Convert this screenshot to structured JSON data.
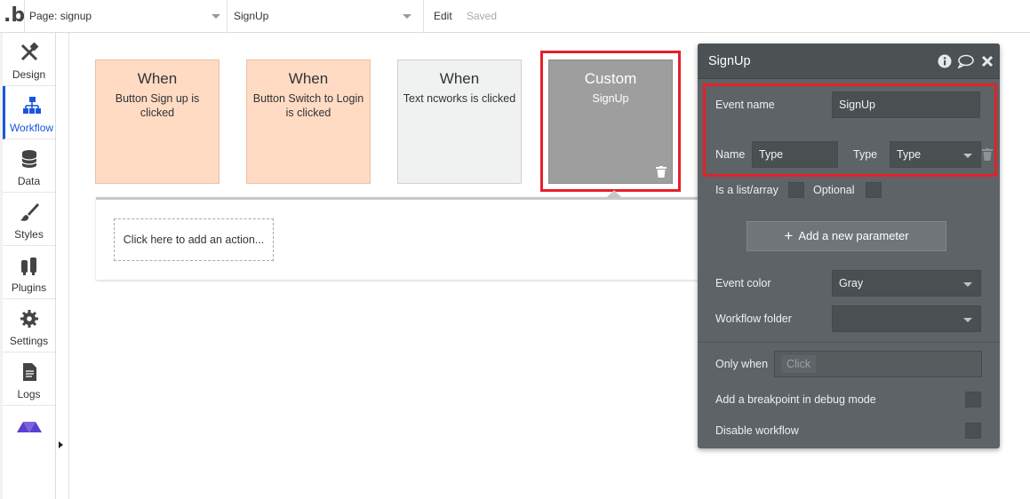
{
  "topbar": {
    "page_select": "Page: signup",
    "workflow_select": "SignUp",
    "edit_label": "Edit",
    "saved_label": "Saved"
  },
  "sidebar": {
    "items": [
      {
        "label": "Design",
        "icon": "design-icon"
      },
      {
        "label": "Workflow",
        "icon": "workflow-icon",
        "active": true
      },
      {
        "label": "Data",
        "icon": "database-icon"
      },
      {
        "label": "Styles",
        "icon": "brush-icon"
      },
      {
        "label": "Plugins",
        "icon": "plug-icon"
      },
      {
        "label": "Settings",
        "icon": "gear-icon"
      },
      {
        "label": "Logs",
        "icon": "document-icon"
      },
      {
        "label": "",
        "icon": "triangles-logo-icon"
      }
    ]
  },
  "cards": [
    {
      "title": "When",
      "subtitle": "Button Sign up is clicked",
      "color": "#ffdbc4"
    },
    {
      "title": "When",
      "subtitle": "Button Switch to Login is clicked",
      "color": "#ffdbc4"
    },
    {
      "title": "When",
      "subtitle": "Text ncworks is clicked",
      "color": "#f0f1f1"
    },
    {
      "title": "Custom",
      "subtitle": "SignUp",
      "color": "#9e9e9e"
    }
  ],
  "canvas": {
    "add_action_label": "Click here to add an action..."
  },
  "panel": {
    "title": "SignUp",
    "event_name_label": "Event name",
    "event_name_value": "SignUp",
    "param_name_label": "Name",
    "param_name_value": "Type",
    "param_type_label": "Type",
    "param_type_value": "Type",
    "is_list_label": "Is a list/array",
    "optional_label": "Optional",
    "add_param_label": "Add a new parameter",
    "event_color_label": "Event color",
    "event_color_value": "Gray",
    "folder_label": "Workflow folder",
    "folder_value": "",
    "only_when_label": "Only when",
    "only_when_placeholder": "Click",
    "breakpoint_label": "Add a breakpoint in debug mode",
    "disable_label": "Disable workflow"
  },
  "colors": {
    "highlight": "#e5202a",
    "accent": "#1a56db",
    "panel_bg": "#5d6366"
  }
}
